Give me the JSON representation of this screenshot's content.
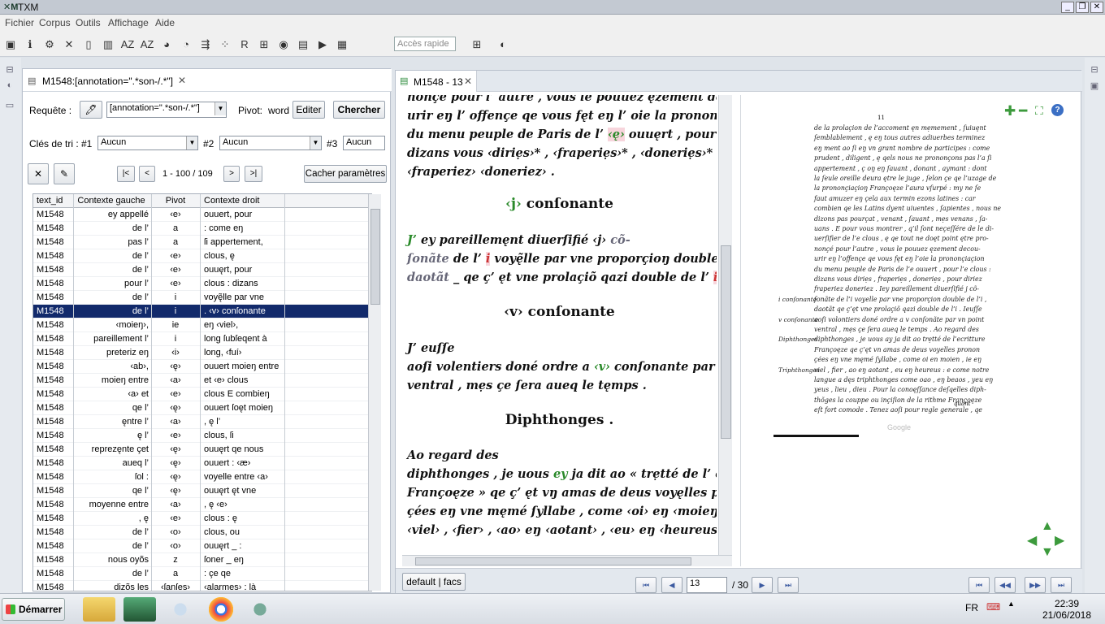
{
  "app": {
    "title": "TXM",
    "logo_text": "TXM"
  },
  "menu": [
    "Fichier",
    "Corpus",
    "Outils",
    "Affichage",
    "Aide"
  ],
  "toolbar": {
    "quick_access_placeholder": "Accès rapide"
  },
  "concordance": {
    "tab_title": "M1548:[annotation=\".*son-/.*\"]",
    "query_label": "Requête :",
    "query_value": "[annotation=\".*son-/.*\"]",
    "pivot_label": "Pivot:",
    "pivot_value": "word",
    "edit_label": "Editer",
    "search_label": "Chercher",
    "sort_label": "Clés de tri :",
    "sort_keys": [
      {
        "num": "#1",
        "value": "Aucun"
      },
      {
        "num": "#2",
        "value": "Aucun"
      },
      {
        "num": "#3",
        "value": "Aucun"
      }
    ],
    "pagination": "1  - 100 / 109",
    "hide_params_label": "Cacher paramètres",
    "columns": [
      "text_id",
      "Contexte gauche",
      "Pivot",
      "Contexte droit"
    ],
    "rows": [
      [
        "M1548",
        "ey appellé",
        "‹e›",
        "ouuert, pour"
      ],
      [
        "M1548",
        "de l’",
        "a",
        ": come eŋ"
      ],
      [
        "M1548",
        "pas l’",
        "a",
        "ſi appertement,"
      ],
      [
        "M1548",
        "de l’",
        "‹e›",
        "clous, ę"
      ],
      [
        "M1548",
        "de l’",
        "‹e›",
        "ouuęrt, pour"
      ],
      [
        "M1548",
        "pour l’",
        "‹e›",
        "clous : dizans"
      ],
      [
        "M1548",
        "de l’",
        "i",
        "voyę̃lle par vne"
      ],
      [
        "M1548",
        "de l’",
        "i",
        ". ‹v› conſonante"
      ],
      [
        "M1548",
        "‹moieŋ›,",
        "ie",
        "eŋ ‹viel›,"
      ],
      [
        "M1548",
        "pareillement l’",
        "i",
        "long ſubſeqent à"
      ],
      [
        "M1548",
        "preteriz eŋ",
        "‹i›",
        "long, ‹fuí›"
      ],
      [
        "M1548",
        "‹ab›,",
        "‹ę›",
        "ouuert moieŋ entre"
      ],
      [
        "M1548",
        "moieŋ entre",
        "‹a›",
        "et ‹e› clous"
      ],
      [
        "M1548",
        "‹a› et",
        "‹e›",
        "clous E combieŋ"
      ],
      [
        "M1548",
        "qe l’",
        "‹ę›",
        "ouuert ſoęt moieŋ"
      ],
      [
        "M1548",
        "ęntre l’",
        "‹a›",
        ", ę l’"
      ],
      [
        "M1548",
        "ę l’",
        "‹e›",
        "clous, ſi"
      ],
      [
        "M1548",
        "reprezęnte çet",
        "‹ę›",
        "ouuęrt qe nous"
      ],
      [
        "M1548",
        "aueq l’",
        "‹ę›",
        "ouuert : ‹æ›"
      ],
      [
        "M1548",
        "ſol :",
        "‹ę›",
        "voyelle entre ‹a›"
      ],
      [
        "M1548",
        "qe l’",
        "‹ę›",
        "ouuęrt ęt vne"
      ],
      [
        "M1548",
        "moyenne entre",
        "‹a›",
        ", ę ‹e›"
      ],
      [
        "M1548",
        ", ę",
        "‹e›",
        "clous : ę"
      ],
      [
        "M1548",
        "de l’",
        "‹o›",
        "clous, ou"
      ],
      [
        "M1548",
        "de l’",
        "‹o›",
        "ouuęrt _ :"
      ],
      [
        "M1548",
        "nous oyõs",
        "z",
        "ſoner _ eŋ"
      ],
      [
        "M1548",
        "de l’",
        "a",
        ": çe qe"
      ],
      [
        "M1548",
        "dizõs les",
        "‹ſanſes›",
        "‹alarmes› : là"
      ]
    ],
    "selected_row": 7
  },
  "editor": {
    "tab_title": "M1548 - 13",
    "lines": [
      "nonçe pour l’ autre , vous le pouuez ęzement decou-",
      "urir eŋ l’ offençe qe vous fęt eŋ l’ oie la prononçiaçioŋ",
      "du menu peuple de Paris de l’ ‹ę› ouuęrt , pour l’ ‹e› clous",
      "dizans vous ‹diriẹs›* , ‹fraperiẹs›* , ‹doneriẹs›* , pour ‹diriez›",
      "‹fraperiez› ‹doneriez› ."
    ],
    "heading1": "‹j› conſonante",
    "para2": [
      "J’ ey pareillemęnt diuerſifié ‹j› cõ-",
      "ſonãte de l’ i voyę̃lle par vne proporçioŋ double de l’ ‹i› ,",
      "daotãt _ qe ç’ ęt vne prolaçiõ qazi double de l’ i ."
    ],
    "heading2": "‹v› conſonante",
    "para3": [
      "J’ euſſe",
      "aoſi volentiers doné ordre a ‹v› conſonante par un point",
      "ventral , mẹs çe ſera aueq le tęmps ."
    ],
    "heading3": "Diphthonges .",
    "para4": [
      "Ao regard des",
      "diphthonges , je uous ey ja dit ao « trẹtté de l’ ecritture",
      "Françoęze » qe ç’ ęt vŋ amas de deus voyęlles pronon-",
      "çées eŋ vne męmé ſyllabe , come ‹oi› eŋ ‹moieŋ› , ie eŋ",
      "‹viel› , ‹fier› , ‹ao› eŋ ‹aotant› , ‹eu› eŋ ‹heureus› :"
    ],
    "facs_page_num": "11",
    "facs_lines": [
      "de la prolaçion de l’accoment ęn mẹmement , ſuiuęnt",
      "ſemblablement , ę eŋ tous autres adiuerbes terminez",
      "eŋ ment ao ſi eŋ vn grant nombre de participes : come",
      "prudent , diligent , ę qels nous ne prononçons pas l’a ſi",
      "appertement , ç oŋ eŋ ſauant , donant , aymant : dont",
      "la ſeule oreille deura ętre le juge , ſelon çe qe l’uzage de",
      "la prononçiaçioŋ Françoęze l’aura vſurpé : my ne ſe",
      "faut amuzer eŋ çela aux termin ezons latines : car",
      "combien qe les Latins dyent uiuentes , ſapientes , nous ne",
      "dizons pas pourçat , venant , ſauant , mẹs venans , ſa-",
      "uans . E pour vous montrer , q’il ſont neçeſſére de le di-",
      "uerſifier de l’e clous , ę qe tout ne doęt point ętre pro-",
      "nonçé pour l’autre , vous le pouuez ęzement decou-",
      "urir eŋ l’offençe qe vous fęt eŋ l’oie la prononçiaçion",
      "du menu peuple de Paris de l’e ouuert , pour l’e clous :",
      "dizans vous diriẹs , fraperiẹs , doneriẹs , pour diriez",
      "fraperiez doneriez . Iey pareillement diuerſifié j cõ-",
      "ſonãte de l’i voyelle par vne proporçion double de l’i ,",
      "daotãt qe ç’ęt vne prolaçiõ qazi double de l’i . Ieuſſe",
      "aoſi volontiers doné ordre a v conſonãte par vn point",
      "ventral , mẹs çe ſera aueq le temps . Ao regard des",
      "diphthonges , je uous ay ja dit ao trẹtté de l’ecritture",
      "Françoęze qe ç’ęt vn amas de deus voyelles pronon",
      "çées eŋ vne męmé ſyllabe , come oi en moien , ie eŋ",
      "viel , fier , ao eŋ aotant , eu eŋ heureus : e come notre",
      "langue a dęs triphthonges come oao , eŋ beaos , yeu eŋ",
      "yeus , lieu , dieu . Pour la conoęſſance deſqelles diph-",
      "thõges la couppe ou inçiſion de la rithme Françoęze",
      "eſt fort comode . Tenez aoſi pour regle generale , qe"
    ],
    "facs_last_word": "quant",
    "facs_watermark": "Google",
    "margin_notes": [
      {
        "text": "i conſonante",
        "line": 17
      },
      {
        "text": "v conſonante",
        "line": 19
      },
      {
        "text": "Diphthonges.",
        "line": 21
      },
      {
        "text": "Triphthonges",
        "line": 24
      }
    ],
    "edition_label": "default | facs",
    "page_current": "13",
    "page_total": "/ 30"
  },
  "taskbar": {
    "start_label": "Démarrer",
    "lang": "FR",
    "time": "22:39",
    "date": "21/06/2018"
  },
  "colors": {
    "selected_row": "#122a6b",
    "green_text": "#2a8a2a",
    "highlight": "#f7d5dc"
  }
}
